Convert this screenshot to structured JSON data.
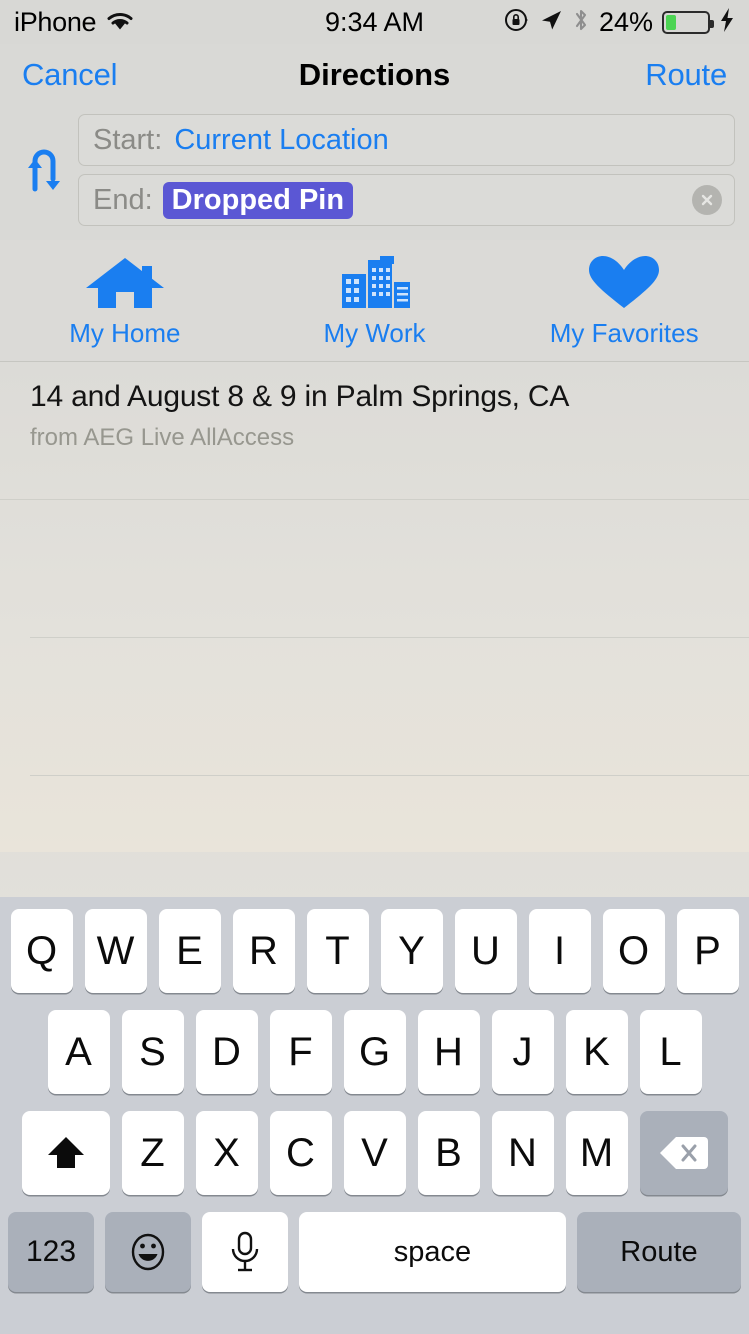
{
  "status_bar": {
    "carrier": "iPhone",
    "wifi_icon": "wifi-icon",
    "time": "9:34 AM",
    "rotation_lock_icon": "rotation-lock-icon",
    "location_icon": "location-arrow-icon",
    "bluetooth_icon": "bluetooth-icon",
    "battery_percent": "24%",
    "battery_level": 24,
    "charging_icon": "lightning-bolt-icon"
  },
  "navbar": {
    "cancel_label": "Cancel",
    "title": "Directions",
    "route_label": "Route"
  },
  "endpoints": {
    "swap_icon": "swap-arrows-icon",
    "start": {
      "label": "Start:",
      "value": "Current Location",
      "selected": false
    },
    "end": {
      "label": "End:",
      "value": "Dropped Pin",
      "selected": true,
      "clear_icon": "clear-circle-icon"
    }
  },
  "shortcuts": [
    {
      "icon": "house-icon",
      "label": "My Home"
    },
    {
      "icon": "buildings-icon",
      "label": "My Work"
    },
    {
      "icon": "heart-icon",
      "label": "My Favorites"
    }
  ],
  "results": [
    {
      "title": "14 and August 8 & 9 in Palm Springs, CA",
      "subtitle": "from AEG Live AllAccess"
    }
  ],
  "keyboard": {
    "row1": [
      "Q",
      "W",
      "E",
      "R",
      "T",
      "Y",
      "U",
      "I",
      "O",
      "P"
    ],
    "row2": [
      "A",
      "S",
      "D",
      "F",
      "G",
      "H",
      "J",
      "K",
      "L"
    ],
    "row3": [
      "Z",
      "X",
      "C",
      "V",
      "B",
      "N",
      "M"
    ],
    "shift_icon": "shift-arrow-icon",
    "backspace_icon": "backspace-delete-icon",
    "numbers_label": "123",
    "emoji_icon": "emoji-smiley-icon",
    "dictation_icon": "microphone-icon",
    "space_label": "space",
    "return_label": "Route"
  },
  "colors": {
    "accent_blue": "#1a7ef0",
    "selection_purple": "#5b57d4",
    "battery_green": "#4cd453",
    "keyboard_bg": "#cbced4",
    "key_white": "#ffffff",
    "key_gray": "#aab0ba"
  }
}
